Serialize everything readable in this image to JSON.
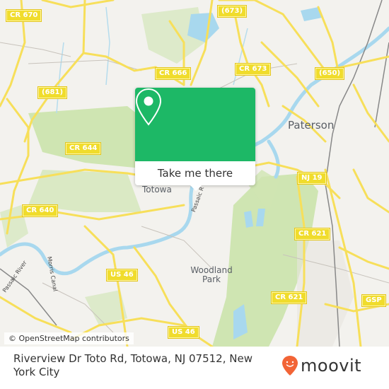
{
  "map": {
    "shields": [
      {
        "label": "CR 670"
      },
      {
        "label": "(673)"
      },
      {
        "label": "CR 666"
      },
      {
        "label": "CR 673"
      },
      {
        "label": "(681)"
      },
      {
        "label": "(650)"
      },
      {
        "label": "CR 644"
      },
      {
        "label": "CR 640"
      },
      {
        "label": "NJ 19"
      },
      {
        "label": "CR 621"
      },
      {
        "label": "US 46"
      },
      {
        "label": "CR 621"
      },
      {
        "label": "GSP"
      },
      {
        "label": "US 46"
      }
    ],
    "places": {
      "paterson": "Paterson",
      "totowa": "Totowa",
      "woodland_park_1": "Woodland",
      "woodland_park_2": "Park"
    },
    "rivers": {
      "passaic_river": "Passaic River",
      "morris_canal": "Morris Canal",
      "passaic_short": "Passaic R"
    },
    "colors": {
      "road": "#f7df5a",
      "water": "#a8d8ee",
      "park": "#c9e2a9",
      "popup_green": "#1db866",
      "moovit_orange": "#f26436"
    }
  },
  "popup": {
    "icon": "location-pin-icon",
    "cta_label": "Take me there"
  },
  "attribution": "© OpenStreetMap contributors",
  "footer": {
    "address": "Riverview Dr Toto Rd, Totowa, NJ 07512, New York City",
    "brand": "moovit",
    "brand_icon": "moovit-pin-icon"
  }
}
